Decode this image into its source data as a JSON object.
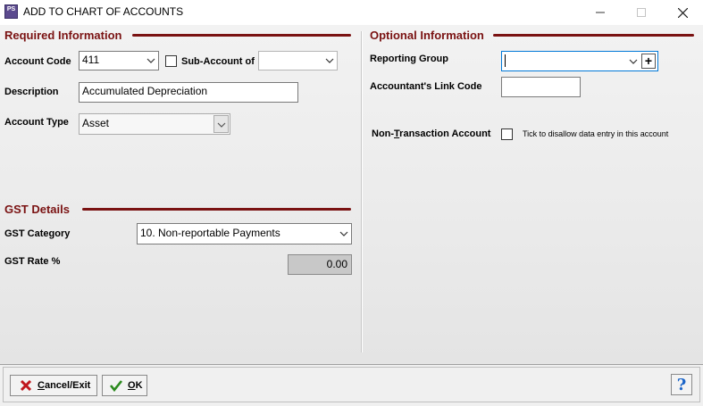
{
  "window": {
    "app_icon_text": "PS",
    "title": "ADD TO CHART OF ACCOUNTS",
    "controls": {
      "minimize_icon": "minimize-icon",
      "maximize_icon": "maximize-icon",
      "close_icon": "close-icon"
    }
  },
  "required": {
    "section_title": "Required Information",
    "account_code_label": "Account Code",
    "account_code_value": "411",
    "sub_account_label": "Sub-Account of",
    "sub_account_value": "",
    "sub_account_checked": false,
    "description_label": "Description",
    "description_value": "Accumulated Depreciation",
    "account_type_label": "Account Type",
    "account_type_value": "Asset"
  },
  "gst": {
    "section_title": "GST Details",
    "category_label": "GST Category",
    "category_value": "10. Non-reportable Payments",
    "rate_label": "GST Rate %",
    "rate_value": "0.00"
  },
  "optional": {
    "section_title": "Optional Information",
    "reporting_group_label": "Reporting Group",
    "reporting_group_value": "",
    "add_button_symbol": "+",
    "link_code_label": "Accountant's Link Code",
    "link_code_value": "",
    "non_transaction_label_pre": "Non-",
    "non_transaction_label_ul": "T",
    "non_transaction_label_post": "ransaction Account",
    "non_transaction_checked": false,
    "non_transaction_hint": "Tick to disallow data entry in this account"
  },
  "footer": {
    "cancel_ul": "C",
    "cancel_rest": "ancel/Exit",
    "ok_ul": "O",
    "ok_rest": "K",
    "help_symbol": "?"
  },
  "colors": {
    "section_accent": "#7a1212",
    "active_border": "#0078d7",
    "cancel_icon": "#c0161d",
    "ok_icon": "#2b8a1e",
    "help_icon": "#1a64c8"
  }
}
